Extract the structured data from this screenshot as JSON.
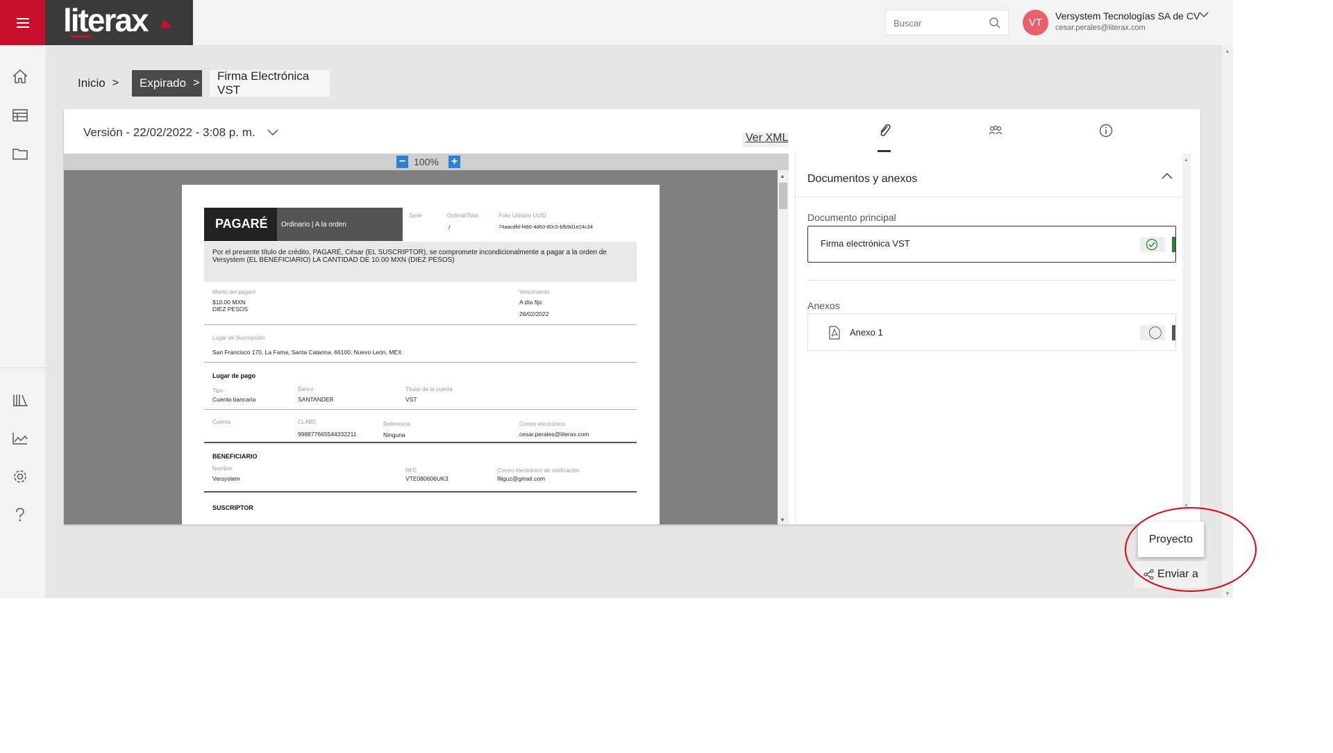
{
  "header": {
    "logo_text": "literax",
    "search_placeholder": "Buscar",
    "user_initials": "VT",
    "company": "Versystem Tecnologías SA de CV",
    "email": "cesar.perales@literax.com"
  },
  "sidebar": {
    "items": [
      "home-icon",
      "table-icon",
      "folder-icon",
      "library-icon",
      "chart-icon",
      "gear-icon",
      "help-icon"
    ]
  },
  "breadcrumb": {
    "home": "Inicio",
    "expired": "Expirado",
    "current": "Firma Electrónica VST"
  },
  "viewer": {
    "version": "Versión - 22/02/2022 - 3:08 p. m.",
    "ver_xml": "Ver XML",
    "zoom_minus": "−",
    "zoom": "100%",
    "zoom_plus": "+"
  },
  "tabs": [
    "attachment-icon",
    "participants-icon",
    "info-icon"
  ],
  "document": {
    "title": "PAGARÉ",
    "subtitle": "Ordinario | A la orden",
    "serie_label": "Serie",
    "ordinal_label": "Ordinal/Total",
    "ordinal_value": "/",
    "folio_label": "Folio Unitario UUID",
    "folio_value": "74aacdfd-f480-4d60-80c5-bfb9d1e24c34",
    "intro": "Por el presente título de crédito, PAGARÉ, César (EL SUSCRIPTOR), se compromete incondicionalmente a pagar a la orden de Versystem (EL BENEFICIARIO) LA CANTIDAD DE 10.00 MXN (DIEZ PESOS)",
    "monto_label": "Monto del pagaré",
    "monto_1": "$10.00 MXN",
    "monto_2": "DIEZ PESOS",
    "venc_label": "Vencimiento",
    "venc_1": "A día fijo",
    "venc_2": "26/02/2022",
    "lugar_sus_label": "Lugar de Suscripción",
    "lugar_sus": "San Francisco 170, La Fama, Santa Catarina, 66100, Nuevo León, MEX",
    "lugar_pago": "Lugar de pago",
    "tipo_label": "Tipo",
    "tipo": "Cuenta bancaria",
    "banco_label": "Banco",
    "banco": "SANTANDER",
    "titular_label": "Titular de la cuenta",
    "titular": "VST",
    "cuenta_label": "Cuenta",
    "clabe_label": "CLABE",
    "clabe": "998877665544332211",
    "referencia_label": "Referencia",
    "referencia": "Ninguna",
    "correo_label": "Correo electrónico",
    "correo": "cesar.perales@literax.com",
    "beneficiario": "BENEFICIARIO",
    "nombre_label": "Nombre",
    "nombre": "Versystem",
    "rfc_label": "RFC",
    "rfc": "VTE080606UK3",
    "correo_notif_label": "Correo electrónico de notificación",
    "correo_notif": "filiguz@gmail.com",
    "suscriptor": "SUSCRIPTOR"
  },
  "panel": {
    "title": "Documentos y anexos",
    "main_label": "Documento principal",
    "main_doc": "Firma electrónica VST",
    "annex_label": "Anexos",
    "annex_1": "Anexo 1"
  },
  "actions": {
    "proyecto": "Proyecto",
    "enviar": "Enviar a"
  },
  "colors": {
    "brand_red": "#c8102e",
    "accent_blue": "#2f80d1",
    "success_green": "#2e7d32",
    "annotation_red": "#e3000f"
  }
}
